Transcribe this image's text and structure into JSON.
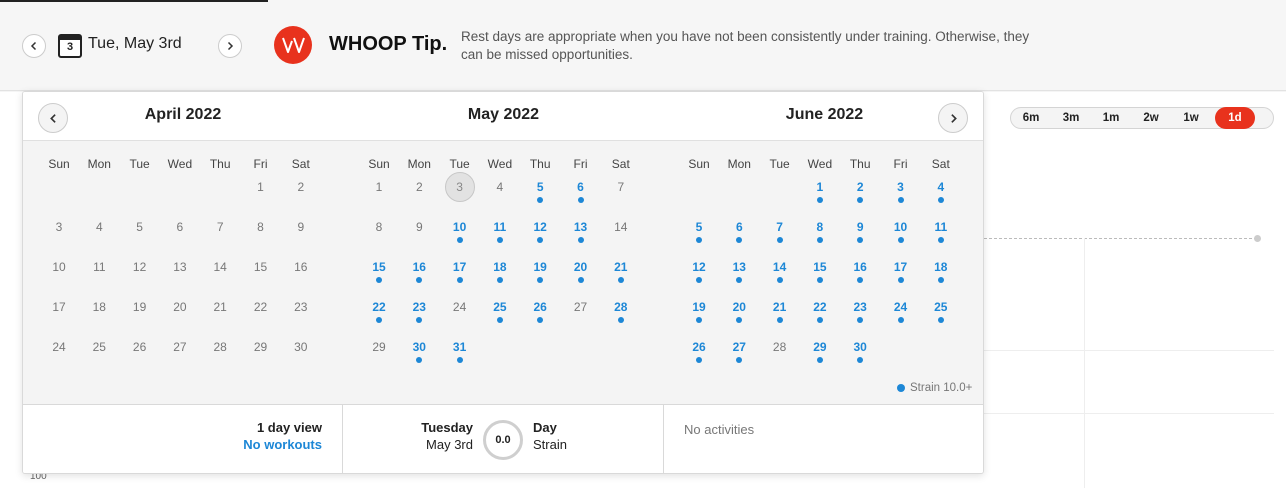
{
  "header": {
    "date_label": "Tue, May 3rd",
    "calendar_icon_day": "3",
    "tip_title": "WHOOP Tip.",
    "tip_text": "Rest days are appropriate when you have not been consistently under training. Otherwise, they can be missed opportunities.",
    "logo_icon": "whoop-logo-icon",
    "accent_color": "#e8321d"
  },
  "range_selector": {
    "options": [
      "6m",
      "3m",
      "1m",
      "2w",
      "1w",
      "1d"
    ],
    "selected": "1d"
  },
  "chart": {
    "y_tick": "100"
  },
  "calendar": {
    "weekdays": [
      "Sun",
      "Mon",
      "Tue",
      "Wed",
      "Thu",
      "Fri",
      "Sat"
    ],
    "months": [
      {
        "title": "April 2022",
        "first_weekday": 5,
        "days_in_month": 30,
        "active_days": [],
        "selected_day": null
      },
      {
        "title": "May 2022",
        "first_weekday": 0,
        "days_in_month": 31,
        "active_days": [
          5,
          6,
          10,
          11,
          12,
          13,
          15,
          16,
          17,
          18,
          19,
          20,
          21,
          22,
          23,
          25,
          26,
          28,
          30,
          31
        ],
        "selected_day": 3
      },
      {
        "title": "June 2022",
        "first_weekday": 3,
        "days_in_month": 30,
        "active_days": [
          1,
          2,
          3,
          4,
          5,
          6,
          7,
          8,
          9,
          10,
          11,
          12,
          13,
          14,
          15,
          16,
          17,
          18,
          19,
          20,
          21,
          22,
          23,
          24,
          25,
          26,
          27,
          29,
          30
        ],
        "selected_day": null
      }
    ],
    "legend_label": "Strain 10.0+",
    "dot_color": "#1d87d6"
  },
  "footer": {
    "view_title": "1 day view",
    "view_link": "No workouts",
    "day_name": "Tuesday",
    "day_date": "May 3rd",
    "strain_value": "0.0",
    "strain_label_top": "Day",
    "strain_label_bottom": "Strain",
    "activities_text": "No activities"
  }
}
